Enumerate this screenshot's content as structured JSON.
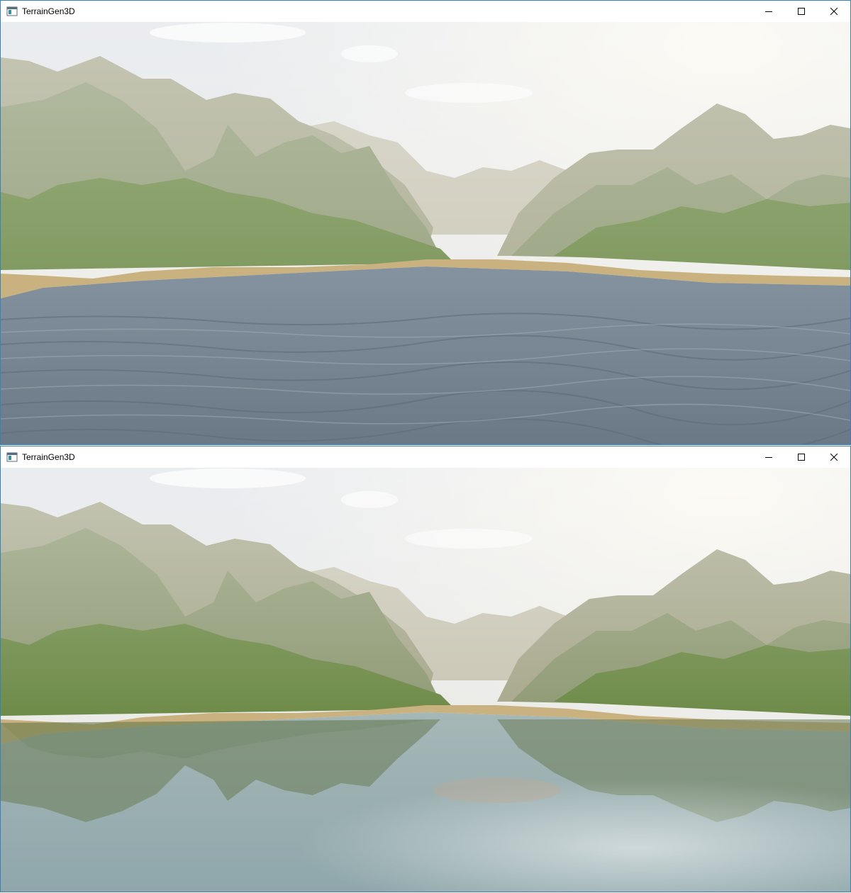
{
  "windows": [
    {
      "title": "TerrainGen3D",
      "icon": "app-window-icon",
      "controls": [
        "minimize-icon",
        "maximize-icon",
        "close-icon"
      ],
      "water_style": "wavy"
    },
    {
      "title": "TerrainGen3D",
      "icon": "app-window-icon",
      "controls": [
        "minimize-icon",
        "maximize-icon",
        "close-icon"
      ],
      "water_style": "reflective"
    }
  ],
  "colors": {
    "window_border": "#3c7fb1",
    "sky_top": "#dfe3e8",
    "sky_glow": "#fbf8ef",
    "mountain_far": "#c9c6b4",
    "mountain_mid": "#8f9a74",
    "mountain_near": "#6d8a47",
    "shore": "#c9b27f",
    "water_wavy": "#6f7f8c",
    "water_reflective": "#9fb3b5"
  }
}
